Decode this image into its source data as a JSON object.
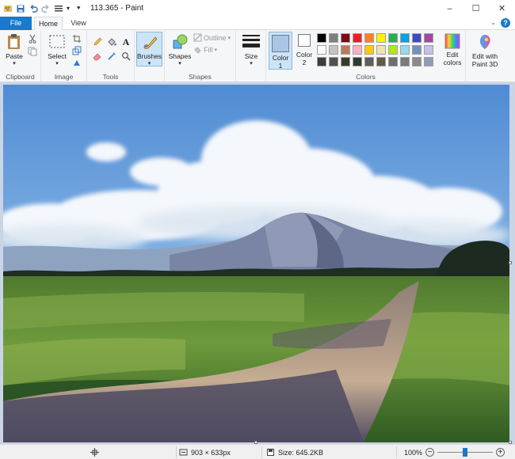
{
  "window": {
    "title": "113.365 - Paint",
    "controls": {
      "minimize": "–",
      "maximize": "☐",
      "close": "✕"
    }
  },
  "tabs": {
    "file": "File",
    "home": "Home",
    "view": "View",
    "help": "?"
  },
  "ribbon": {
    "clipboard": {
      "label": "Clipboard",
      "paste": "Paste"
    },
    "image": {
      "label": "Image",
      "select": "Select"
    },
    "tools": {
      "label": "Tools",
      "text_tool": "A"
    },
    "brushes": {
      "label": "Brushes"
    },
    "shapes": {
      "label": "Shapes",
      "shapes_button": "Shapes",
      "outline": "Outline",
      "fill": "Fill"
    },
    "size": {
      "label": "Size"
    },
    "colors": {
      "label": "Colors",
      "color1": "Color\n1",
      "color1_line1": "Color",
      "color1_line2": "1",
      "color2_line1": "Color",
      "color2_line2": "2",
      "edit_colors_line1": "Edit",
      "edit_colors_line2": "colors",
      "palette_row1": [
        "#000000",
        "#7f7f7f",
        "#880015",
        "#ed1c24",
        "#ff7f27",
        "#fff200",
        "#22b14c",
        "#00a2e8",
        "#3f48cc",
        "#a349a4"
      ],
      "palette_row2": [
        "#ffffff",
        "#c3c3c3",
        "#b97a57",
        "#ffaec9",
        "#ffc90e",
        "#efe4b0",
        "#b5e61d",
        "#99d9ea",
        "#7092be",
        "#c8bfe7"
      ],
      "palette_row3": [
        "#3c3c3c",
        "#505050",
        "#3a3a2a",
        "#2f3b2f",
        "#5e5e5e",
        "#5f5a4a",
        "#6e6e6e",
        "#7b7b7b",
        "#8a8a8a",
        "#8e9cb8"
      ],
      "color1_value": "#a9c6e8",
      "color2_value": "#ffffff"
    },
    "paint3d": {
      "line1": "Edit with",
      "line2": "Paint 3D"
    }
  },
  "status": {
    "dimensions": "903 × 633px",
    "size": "Size: 645.2KB",
    "zoom": "100%",
    "zoom_minus": "−",
    "zoom_plus": "+",
    "zoom_slider_level": 0.5
  }
}
